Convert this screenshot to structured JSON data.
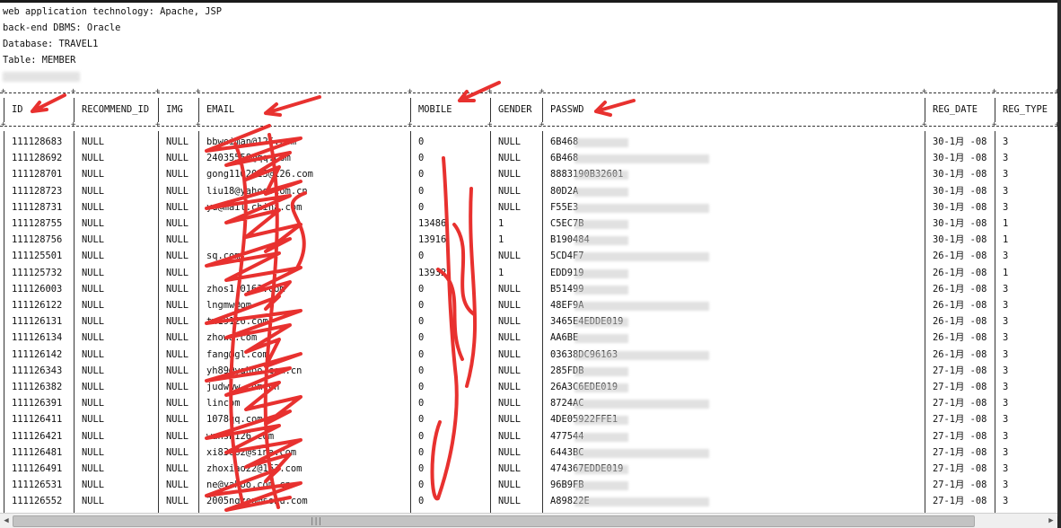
{
  "info_lines": [
    "web application technology: Apache, JSP",
    "back-end DBMS: Oracle",
    "Database: TRAVEL1",
    "Table: MEMBER"
  ],
  "table": {
    "columns": [
      "ID",
      "RECOMMEND_ID",
      "IMG",
      "EMAIL",
      "MOBILE",
      "GENDER",
      "PASSWD",
      "REG_DATE",
      "REG_TYPE"
    ],
    "rows": [
      [
        "111128683",
        "NULL",
        "NULL",
        "bbweiman@126.com",
        "0",
        "NULL",
        "6B468",
        "30-1月 -08",
        "3"
      ],
      [
        "111128692",
        "NULL",
        "NULL",
        "24035558@qq.com",
        "0",
        "NULL",
        "6B468",
        "30-1月 -08",
        "3"
      ],
      [
        "111128701",
        "NULL",
        "NULL",
        "gong1102023@126.com",
        "0",
        "NULL",
        "8883190B32601",
        "30-1月 -08",
        "3"
      ],
      [
        "111128723",
        "NULL",
        "NULL",
        "liu18@yahoo.com.cn",
        "0",
        "NULL",
        "80D2A",
        "30-1月 -08",
        "3"
      ],
      [
        "111128731",
        "NULL",
        "NULL",
        "yu@mail.china.com",
        "0",
        "NULL",
        "F55E3",
        "30-1月 -08",
        "3"
      ],
      [
        "111128755",
        "NULL",
        "NULL",
        "",
        "13486",
        "1",
        "C5EC7B",
        "30-1月 -08",
        "1"
      ],
      [
        "111128756",
        "NULL",
        "NULL",
        "",
        "13916",
        "1",
        "B190484",
        "30-1月 -08",
        "1"
      ],
      [
        "111125501",
        "NULL",
        "NULL",
        "sq.com",
        "0",
        "NULL",
        "5CD4F7",
        "26-1月 -08",
        "3"
      ],
      [
        "111125732",
        "NULL",
        "NULL",
        "",
        "13932",
        "1",
        "EDD919",
        "26-1月 -08",
        "1"
      ],
      [
        "111126003",
        "NULL",
        "NULL",
        "zhos1.0163.com",
        "0",
        "NULL",
        "B51499",
        "26-1月 -08",
        "3"
      ],
      [
        "111126122",
        "NULL",
        "NULL",
        "lngmw@om",
        "0",
        "NULL",
        "48EF9A",
        "26-1月 -08",
        "3"
      ],
      [
        "111126131",
        "NULL",
        "NULL",
        "tw19126.com",
        "0",
        "NULL",
        "3465E4EDDE019",
        "26-1月 -08",
        "3"
      ],
      [
        "111126134",
        "NULL",
        "NULL",
        "zhowa.com",
        "0",
        "NULL",
        "AA6BE",
        "26-1月 -08",
        "3"
      ],
      [
        "111126142",
        "NULL",
        "NULL",
        "fang@gl.com",
        "0",
        "NULL",
        "03638DC96163",
        "26-1月 -08",
        "3"
      ],
      [
        "111126343",
        "NULL",
        "NULL",
        "yh89@yahoo.com.cn",
        "0",
        "NULL",
        "285FDB",
        "27-1月 -08",
        "3"
      ],
      [
        "111126382",
        "NULL",
        "NULL",
        "judwww.com.cn",
        "0",
        "NULL",
        "26A3C6EDE019",
        "27-1月 -08",
        "3"
      ],
      [
        "111126391",
        "NULL",
        "NULL",
        "lincom",
        "0",
        "NULL",
        "8724AC",
        "27-1月 -08",
        "3"
      ],
      [
        "111126411",
        "NULL",
        "NULL",
        "1078qq.com",
        "0",
        "NULL",
        "4DE05922FFE1",
        "27-1月 -08",
        "3"
      ],
      [
        "111126421",
        "NULL",
        "NULL",
        "wansh126.com",
        "0",
        "NULL",
        "477544",
        "27-1月 -08",
        "3"
      ],
      [
        "111126481",
        "NULL",
        "NULL",
        "xi83062@sina.com",
        "0",
        "NULL",
        "6443BC",
        "27-1月 -08",
        "3"
      ],
      [
        "111126491",
        "NULL",
        "NULL",
        "zhoxiao22@163.com",
        "0",
        "NULL",
        "474367EDDE019",
        "27-1月 -08",
        "3"
      ],
      [
        "111126531",
        "NULL",
        "NULL",
        "ne@yahoo.com.cn",
        "0",
        "NULL",
        "96B9FB",
        "27-1月 -08",
        "3"
      ],
      [
        "111126552",
        "NULL",
        "NULL",
        "2005ngzou@sohu.com",
        "0",
        "NULL",
        "A89822E",
        "27-1月 -08",
        "3"
      ]
    ]
  },
  "annotation_color": "#e8312f"
}
